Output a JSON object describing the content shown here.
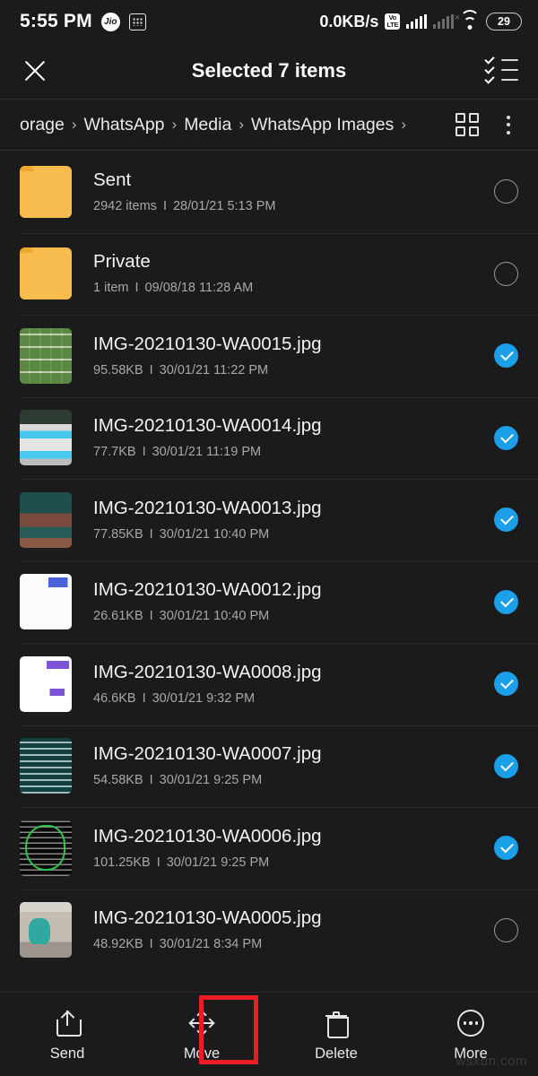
{
  "status_bar": {
    "time": "5:55 PM",
    "carrier_badge": "Jio",
    "grid_badge_icon": "dots-grid-icon",
    "network_speed": "0.0KB/s",
    "volte_label_top": "Vo",
    "volte_label_bottom": "LTE",
    "sim1_icon": "signal-bars-full-icon",
    "sim2_icon": "signal-bars-no-service-icon",
    "wifi_icon": "wifi-icon",
    "battery_level": "29"
  },
  "app_bar": {
    "close_icon": "close-icon",
    "title": "Selected 7 items",
    "select_all_icon": "select-all-checklist-icon"
  },
  "breadcrumb": {
    "items": [
      {
        "label": "orage"
      },
      {
        "label": "WhatsApp"
      },
      {
        "label": "Media"
      },
      {
        "label": "WhatsApp Images"
      }
    ],
    "separator": "›",
    "grid_view_icon": "grid-view-icon",
    "overflow_icon": "more-vertical-icon"
  },
  "file_list": [
    {
      "name": "Sent",
      "size": "2942 items",
      "date": "28/01/21 5:13 PM",
      "separator": "I",
      "type": "folder",
      "thumb": "folder-icon",
      "selected": false
    },
    {
      "name": "Private",
      "size": "1 item",
      "date": "09/08/18 11:28 AM",
      "separator": "I",
      "type": "folder",
      "thumb": "folder-icon",
      "selected": false
    },
    {
      "name": "IMG-20210130-WA0015.jpg",
      "size": "95.58KB",
      "date": "30/01/21 11:22 PM",
      "separator": "I",
      "type": "image",
      "thumb": "t-collage",
      "selected": true
    },
    {
      "name": "IMG-20210130-WA0014.jpg",
      "size": "77.7KB",
      "date": "30/01/21 11:19 PM",
      "separator": "I",
      "type": "image",
      "thumb": "t-screenshot",
      "selected": true
    },
    {
      "name": "IMG-20210130-WA0013.jpg",
      "size": "77.85KB",
      "date": "30/01/21 10:40 PM",
      "separator": "I",
      "type": "image",
      "thumb": "t-chat-dark",
      "selected": true
    },
    {
      "name": "IMG-20210130-WA0012.jpg",
      "size": "26.61KB",
      "date": "30/01/21 10:40 PM",
      "separator": "I",
      "type": "image",
      "thumb": "t-chat-white",
      "selected": true
    },
    {
      "name": "IMG-20210130-WA0008.jpg",
      "size": "46.6KB",
      "date": "30/01/21 9:32 PM",
      "separator": "I",
      "type": "image",
      "thumb": "t-chat-purple",
      "selected": true
    },
    {
      "name": "IMG-20210130-WA0007.jpg",
      "size": "54.58KB",
      "date": "30/01/21 9:25 PM",
      "separator": "I",
      "type": "image",
      "thumb": "t-teal-doc",
      "selected": true
    },
    {
      "name": "IMG-20210130-WA0006.jpg",
      "size": "101.25KB",
      "date": "30/01/21 9:25 PM",
      "separator": "I",
      "type": "image",
      "thumb": "t-black-note",
      "selected": true
    },
    {
      "name": "IMG-20210130-WA0005.jpg",
      "size": "48.92KB",
      "date": "30/01/21 8:34 PM",
      "separator": "I",
      "type": "image",
      "thumb": "t-meme",
      "selected": false
    }
  ],
  "bottom_bar": {
    "actions": [
      {
        "label": "Send",
        "icon": "share-icon",
        "highlighted": false
      },
      {
        "label": "Move",
        "icon": "move-icon",
        "highlighted": true
      },
      {
        "label": "Delete",
        "icon": "trash-icon",
        "highlighted": false
      },
      {
        "label": "More",
        "icon": "more-circle-icon",
        "highlighted": false
      }
    ]
  },
  "watermark": "wsxdn.com",
  "colors": {
    "background": "#1b1b1b",
    "accent_checked": "#1a9fe8",
    "folder": "#f7bb4e",
    "highlight": "#ec1c24"
  }
}
